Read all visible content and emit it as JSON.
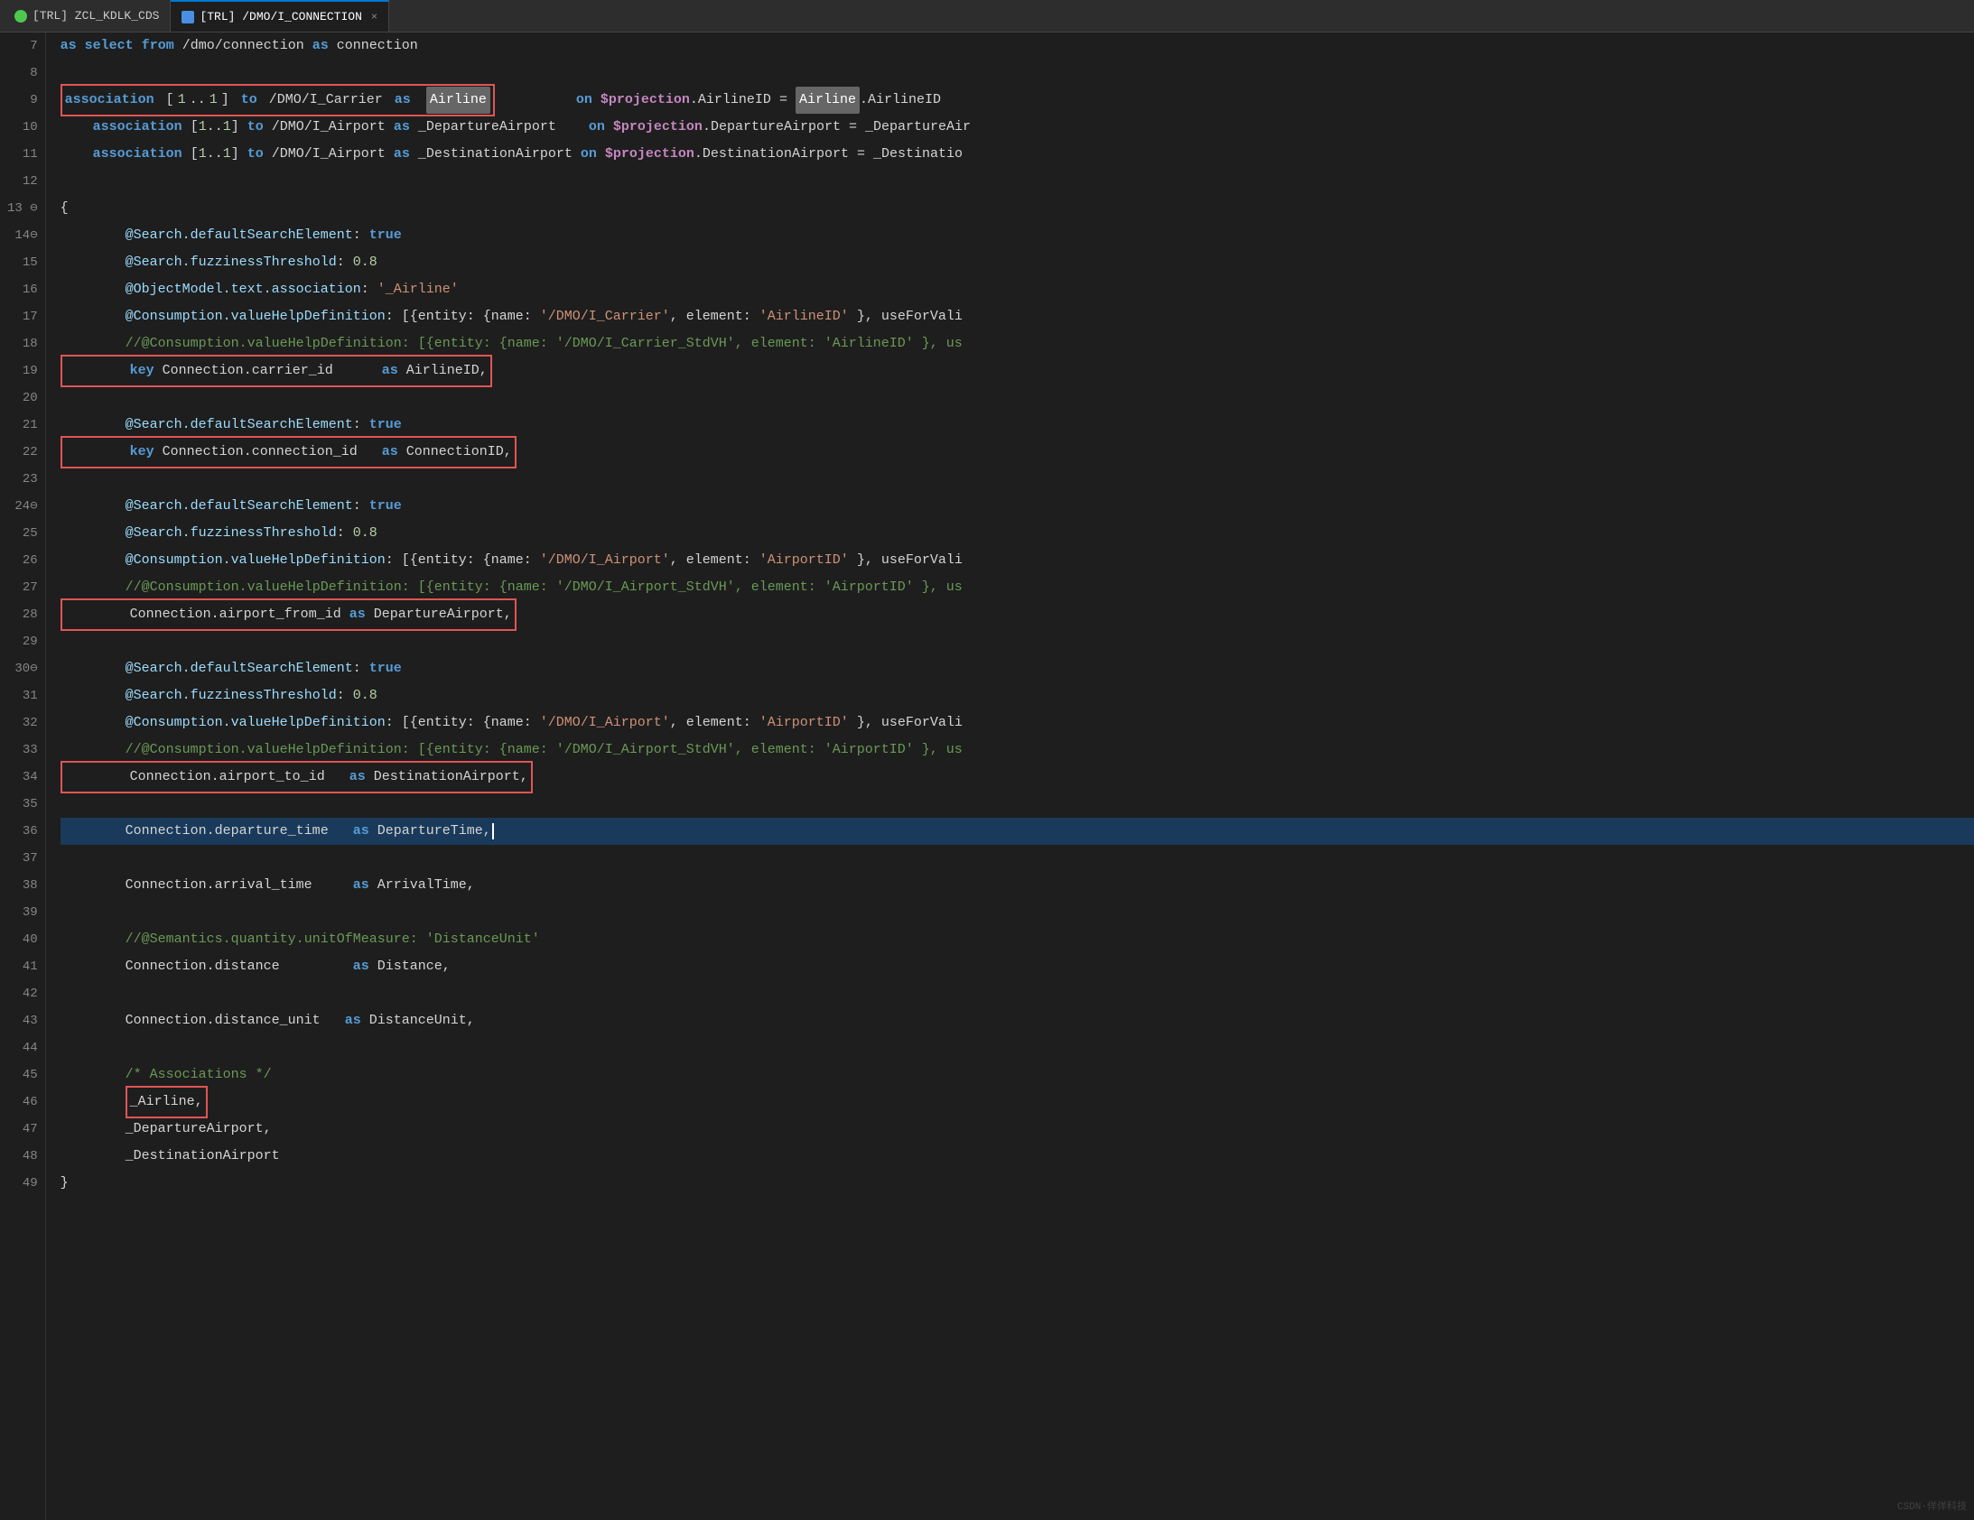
{
  "tabs": [
    {
      "id": "tab1",
      "icon": "green",
      "label": "[TRL] ZCL_KDLK_CDS",
      "closable": false,
      "active": false
    },
    {
      "id": "tab2",
      "icon": "blue",
      "label": "[TRL] /DMO/I_CONNECTION",
      "closable": true,
      "active": true
    }
  ],
  "lines": [
    {
      "num": 7,
      "fold": false,
      "highlighted": false,
      "content": "as_select_from_/dmo/connection_as_connection"
    },
    {
      "num": 8,
      "fold": false,
      "highlighted": false,
      "content": ""
    },
    {
      "num": 9,
      "fold": false,
      "highlighted": false,
      "content": "line9",
      "redbox": true
    },
    {
      "num": 10,
      "fold": false,
      "highlighted": false,
      "content": "line10"
    },
    {
      "num": 11,
      "fold": false,
      "highlighted": false,
      "content": "line11"
    },
    {
      "num": 12,
      "fold": false,
      "highlighted": false,
      "content": ""
    },
    {
      "num": 13,
      "fold": true,
      "highlighted": false,
      "content": "{"
    },
    {
      "num": 14,
      "fold": true,
      "highlighted": false,
      "content": "line14"
    },
    {
      "num": 15,
      "fold": false,
      "highlighted": false,
      "content": "line15"
    },
    {
      "num": 16,
      "fold": false,
      "highlighted": false,
      "content": "line16"
    },
    {
      "num": 17,
      "fold": false,
      "highlighted": false,
      "content": "line17"
    },
    {
      "num": 18,
      "fold": false,
      "highlighted": false,
      "content": "line18"
    },
    {
      "num": 19,
      "fold": false,
      "highlighted": false,
      "content": "line19",
      "redbox": true
    },
    {
      "num": 20,
      "fold": false,
      "highlighted": false,
      "content": ""
    },
    {
      "num": 21,
      "fold": false,
      "highlighted": false,
      "content": "line21"
    },
    {
      "num": 22,
      "fold": false,
      "highlighted": false,
      "content": "line22",
      "redbox": true
    },
    {
      "num": 23,
      "fold": false,
      "highlighted": false,
      "content": ""
    },
    {
      "num": 24,
      "fold": true,
      "highlighted": false,
      "content": "line24"
    },
    {
      "num": 25,
      "fold": false,
      "highlighted": false,
      "content": "line25"
    },
    {
      "num": 26,
      "fold": false,
      "highlighted": false,
      "content": "line26"
    },
    {
      "num": 27,
      "fold": false,
      "highlighted": false,
      "content": "line27"
    },
    {
      "num": 28,
      "fold": false,
      "highlighted": false,
      "content": "line28",
      "redbox": true
    },
    {
      "num": 29,
      "fold": false,
      "highlighted": false,
      "content": ""
    },
    {
      "num": 30,
      "fold": true,
      "highlighted": false,
      "content": "line30"
    },
    {
      "num": 31,
      "fold": false,
      "highlighted": false,
      "content": "line31"
    },
    {
      "num": 32,
      "fold": false,
      "highlighted": false,
      "content": "line32"
    },
    {
      "num": 33,
      "fold": false,
      "highlighted": false,
      "content": "line33"
    },
    {
      "num": 34,
      "fold": false,
      "highlighted": false,
      "content": "line34",
      "redbox": true
    },
    {
      "num": 35,
      "fold": false,
      "highlighted": false,
      "content": ""
    },
    {
      "num": 36,
      "fold": false,
      "highlighted": true,
      "content": "line36"
    },
    {
      "num": 37,
      "fold": false,
      "highlighted": false,
      "content": ""
    },
    {
      "num": 38,
      "fold": false,
      "highlighted": false,
      "content": "line38"
    },
    {
      "num": 39,
      "fold": false,
      "highlighted": false,
      "content": ""
    },
    {
      "num": 40,
      "fold": false,
      "highlighted": false,
      "content": "line40"
    },
    {
      "num": 41,
      "fold": false,
      "highlighted": false,
      "content": "line41"
    },
    {
      "num": 42,
      "fold": false,
      "highlighted": false,
      "content": ""
    },
    {
      "num": 43,
      "fold": false,
      "highlighted": false,
      "content": "line43"
    },
    {
      "num": 44,
      "fold": false,
      "highlighted": false,
      "content": ""
    },
    {
      "num": 45,
      "fold": false,
      "highlighted": false,
      "content": "line45"
    },
    {
      "num": 46,
      "fold": false,
      "highlighted": false,
      "content": "line46",
      "redbox": true
    },
    {
      "num": 47,
      "fold": false,
      "highlighted": false,
      "content": "line47"
    },
    {
      "num": 48,
      "fold": false,
      "highlighted": false,
      "content": "line48"
    },
    {
      "num": 49,
      "fold": false,
      "highlighted": false,
      "content": "}"
    }
  ]
}
